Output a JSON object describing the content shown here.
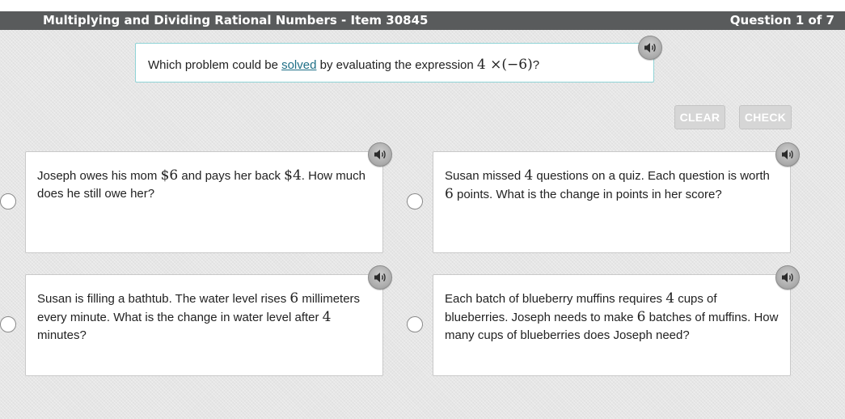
{
  "header": {
    "title": "Multiplying and Dividing Rational Numbers - Item 30845",
    "question_counter": "Question 1 of 7"
  },
  "question": {
    "text_before": "Which problem could be ",
    "link_text": "solved",
    "text_after": " by evaluating the expression ",
    "expression": "4 ×(−6)",
    "end": "?"
  },
  "buttons": {
    "clear": "CLEAR",
    "check": "CHECK"
  },
  "options": [
    {
      "p1": "Joseph owes his mom ",
      "m1": "$6",
      "p2": " and pays her back ",
      "m2": "$4",
      "p3": ". How much does he still owe her?"
    },
    {
      "p1": "Susan missed ",
      "m1": "4",
      "p2": " questions on a quiz. Each question is worth ",
      "m2": "6",
      "p3": " points. What is the change in points in her score?"
    },
    {
      "p1": "Susan is filling a bathtub. The water level rises ",
      "m1": "6",
      "p2": " millimeters every minute. What is the change in water level after ",
      "m2": "4",
      "p3": " minutes?"
    },
    {
      "p1": "Each batch of blueberry muffins requires ",
      "m1": "4",
      "p2": " cups of blueberries. Joseph needs to make ",
      "m2": "6",
      "p3": " batches of muffins. How many cups of blueberries does Joseph need?"
    }
  ],
  "icons": {
    "audio": "speaker-icon",
    "radio": "radio-button"
  },
  "colors": {
    "header_bg": "#595b5c",
    "link": "#1e6f86",
    "question_border": "#8fd3d6"
  }
}
